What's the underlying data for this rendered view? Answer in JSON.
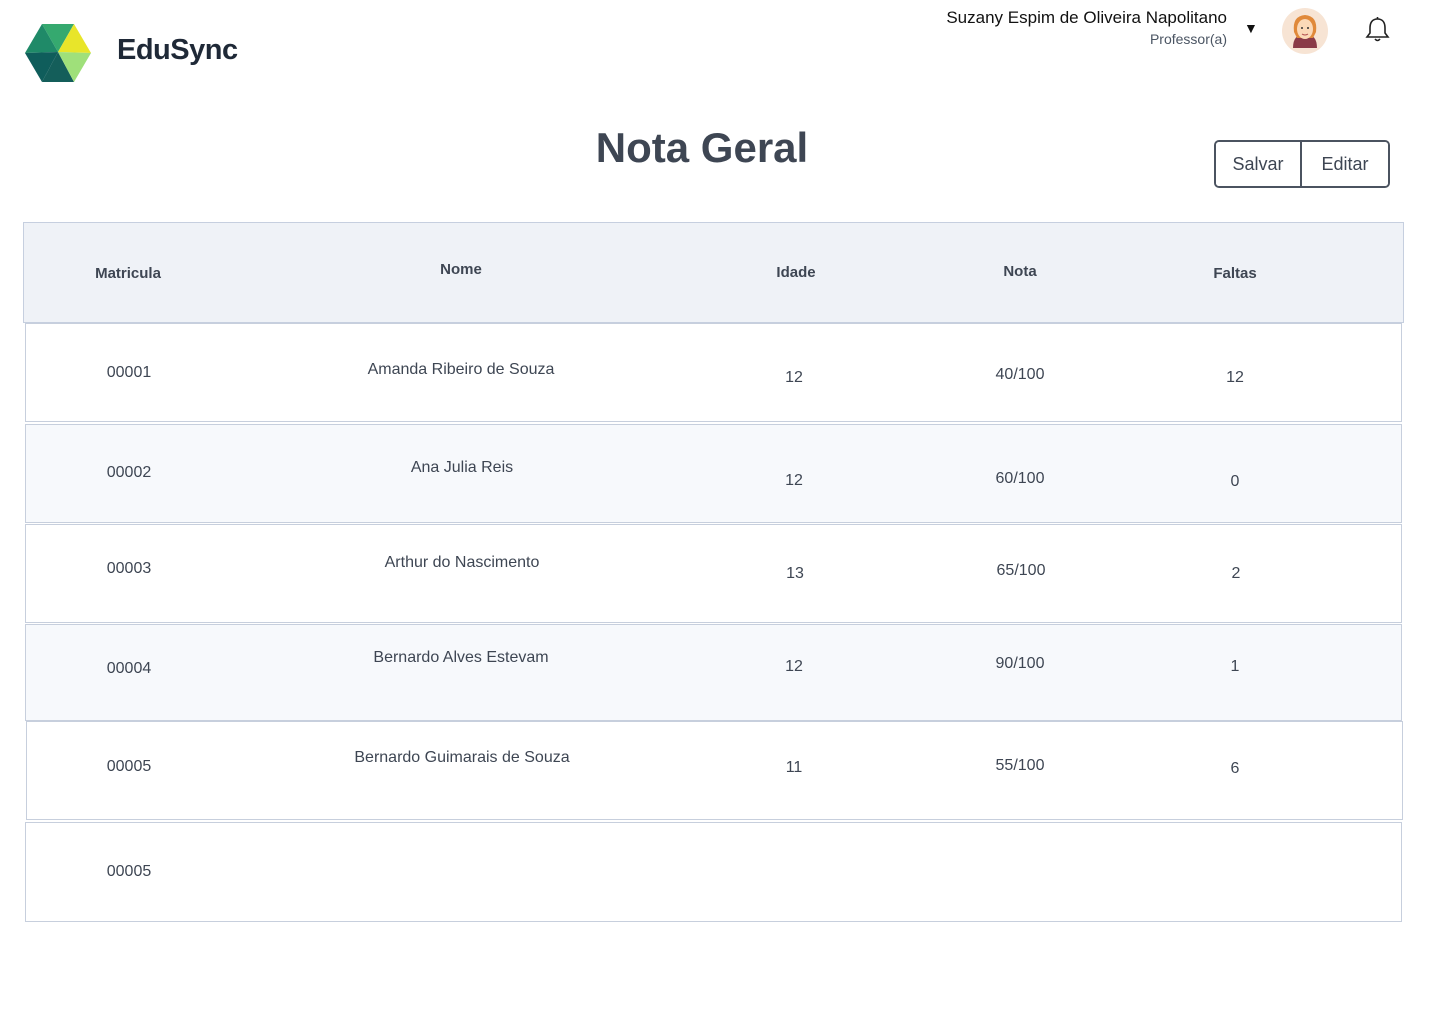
{
  "header": {
    "brand": "EduSync",
    "user_name": "Suzany Espim de Oliveira Napolitano",
    "user_role": "Professor(a)",
    "caret_icon": "caret-down-icon",
    "avatar_icon": "user-avatar",
    "notification_icon": "bell-icon"
  },
  "page": {
    "title": "Nota Geral",
    "save_label": "Salvar",
    "edit_label": "Editar"
  },
  "colors": {
    "header_bg": "#eff2f7",
    "row_alt_bg": "#f7f9fc",
    "border": "#c7cfdd",
    "text": "#3e4653",
    "logo_green": "#2e9e6b",
    "logo_yellow": "#e8e52a",
    "logo_lightgreen": "#9fe07a",
    "logo_teal": "#0f5d5b"
  },
  "table": {
    "columns": [
      "Matricula",
      "Nome",
      "Idade",
      "Nota",
      "Faltas"
    ],
    "rows": [
      {
        "matricula": "00001",
        "nome": "Amanda Ribeiro de Souza",
        "idade": "12",
        "nota": "40/100",
        "faltas": "12"
      },
      {
        "matricula": "00002",
        "nome": "Ana Julia Reis",
        "idade": "12",
        "nota": "60/100",
        "faltas": "0"
      },
      {
        "matricula": "00003",
        "nome": "Arthur do Nascimento",
        "idade": "13",
        "nota": "65/100",
        "faltas": "2"
      },
      {
        "matricula": "00004",
        "nome": "Bernardo Alves Estevam",
        "idade": "12",
        "nota": "90/100",
        "faltas": "1"
      },
      {
        "matricula": "00005",
        "nome": "Bernardo Guimarais de Souza",
        "idade": "11",
        "nota": "55/100",
        "faltas": "6"
      },
      {
        "matricula": "00005",
        "nome": "",
        "idade": "",
        "nota": "",
        "faltas": ""
      }
    ]
  }
}
